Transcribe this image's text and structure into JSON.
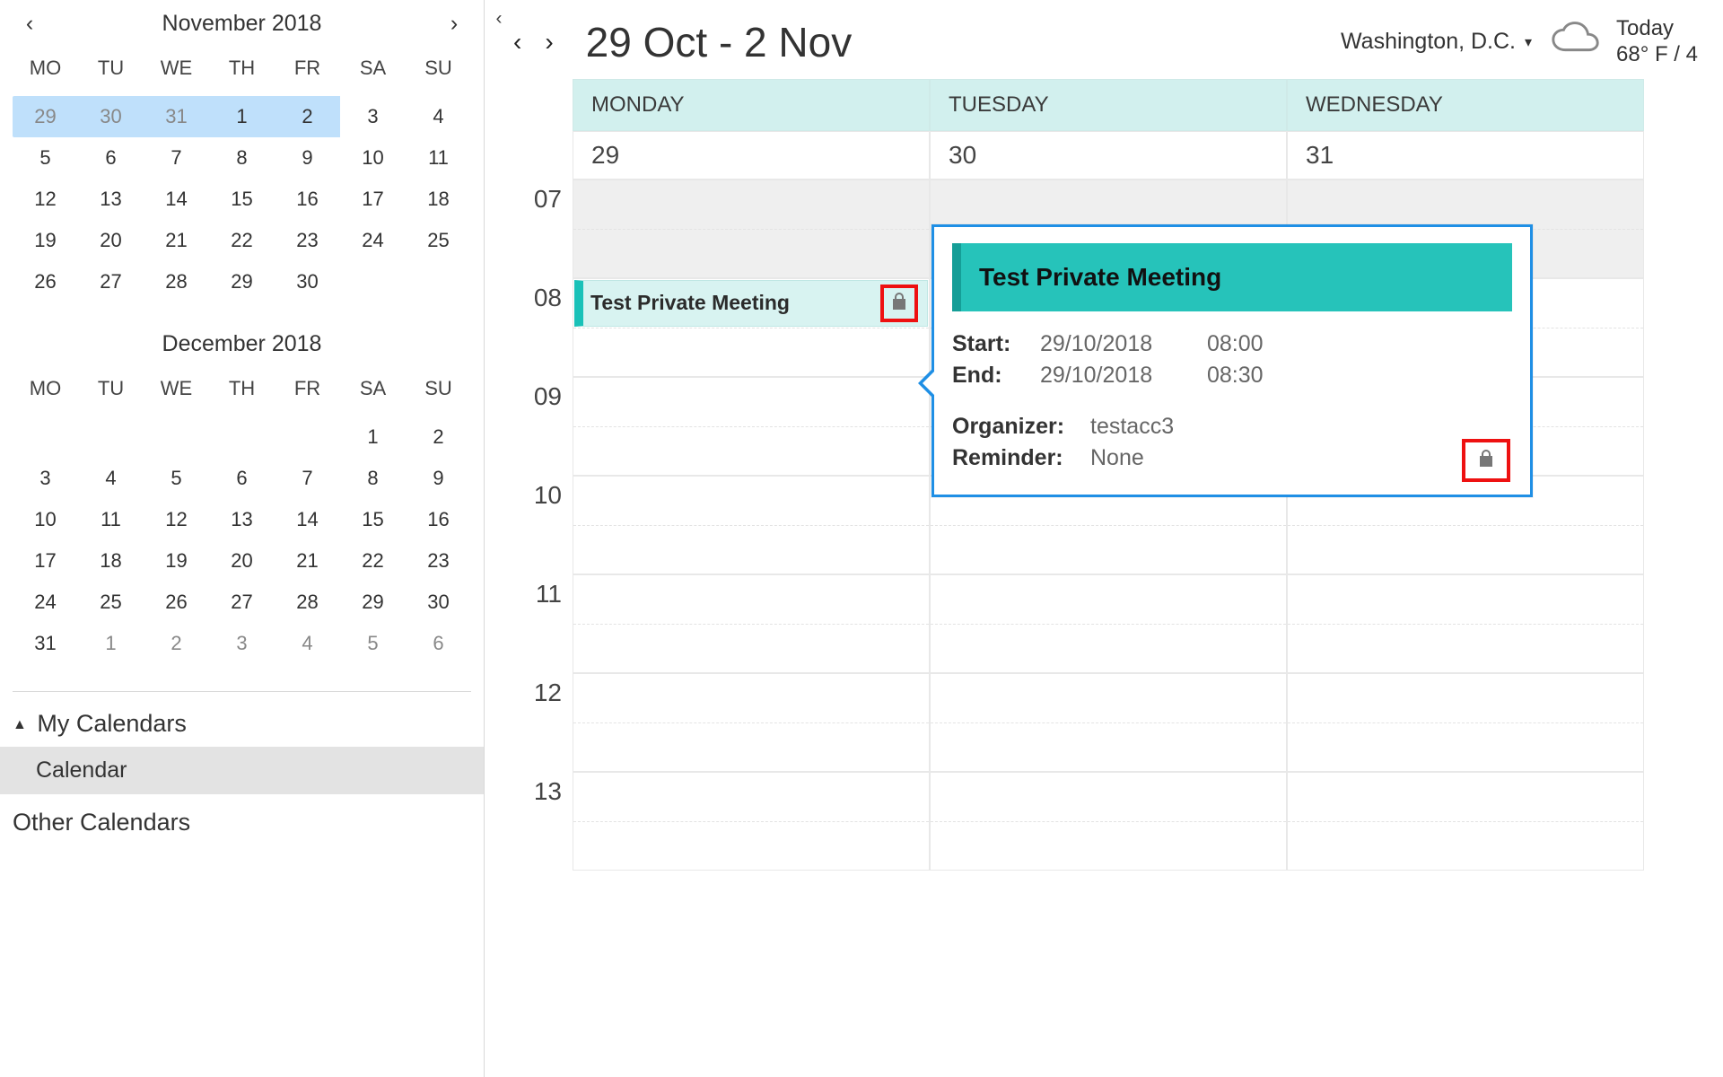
{
  "sidebar": {
    "collapse_icon": "chevron-left",
    "minis": [
      {
        "title": "November 2018",
        "show_nav": true,
        "dow": [
          "MO",
          "TU",
          "WE",
          "TH",
          "FR",
          "SA",
          "SU"
        ],
        "weeks": [
          {
            "cells": [
              {
                "n": "29",
                "cls": "prev sel"
              },
              {
                "n": "30",
                "cls": "prev sel"
              },
              {
                "n": "31",
                "cls": "prev sel"
              },
              {
                "n": "1",
                "cls": "sel"
              },
              {
                "n": "2",
                "cls": "sel"
              },
              {
                "n": "3"
              },
              {
                "n": "4"
              }
            ]
          },
          {
            "cells": [
              {
                "n": "5"
              },
              {
                "n": "6"
              },
              {
                "n": "7"
              },
              {
                "n": "8"
              },
              {
                "n": "9"
              },
              {
                "n": "10"
              },
              {
                "n": "11"
              }
            ]
          },
          {
            "cells": [
              {
                "n": "12"
              },
              {
                "n": "13"
              },
              {
                "n": "14"
              },
              {
                "n": "15"
              },
              {
                "n": "16"
              },
              {
                "n": "17"
              },
              {
                "n": "18"
              }
            ]
          },
          {
            "cells": [
              {
                "n": "19"
              },
              {
                "n": "20"
              },
              {
                "n": "21"
              },
              {
                "n": "22"
              },
              {
                "n": "23"
              },
              {
                "n": "24"
              },
              {
                "n": "25"
              }
            ]
          },
          {
            "cells": [
              {
                "n": "26"
              },
              {
                "n": "27"
              },
              {
                "n": "28"
              },
              {
                "n": "29"
              },
              {
                "n": "30"
              },
              {
                "n": "",
                "cls": "blank"
              },
              {
                "n": "",
                "cls": "blank"
              }
            ]
          }
        ]
      },
      {
        "title": "December 2018",
        "show_nav": false,
        "dow": [
          "MO",
          "TU",
          "WE",
          "TH",
          "FR",
          "SA",
          "SU"
        ],
        "weeks": [
          {
            "cells": [
              {
                "n": ""
              },
              {
                "n": ""
              },
              {
                "n": ""
              },
              {
                "n": ""
              },
              {
                "n": ""
              },
              {
                "n": "1"
              },
              {
                "n": "2"
              }
            ]
          },
          {
            "cells": [
              {
                "n": "3"
              },
              {
                "n": "4"
              },
              {
                "n": "5"
              },
              {
                "n": "6"
              },
              {
                "n": "7"
              },
              {
                "n": "8"
              },
              {
                "n": "9"
              }
            ]
          },
          {
            "cells": [
              {
                "n": "10"
              },
              {
                "n": "11"
              },
              {
                "n": "12"
              },
              {
                "n": "13"
              },
              {
                "n": "14"
              },
              {
                "n": "15"
              },
              {
                "n": "16"
              }
            ]
          },
          {
            "cells": [
              {
                "n": "17"
              },
              {
                "n": "18"
              },
              {
                "n": "19"
              },
              {
                "n": "20"
              },
              {
                "n": "21"
              },
              {
                "n": "22"
              },
              {
                "n": "23"
              }
            ]
          },
          {
            "cells": [
              {
                "n": "24"
              },
              {
                "n": "25"
              },
              {
                "n": "26"
              },
              {
                "n": "27"
              },
              {
                "n": "28"
              },
              {
                "n": "29"
              },
              {
                "n": "30"
              }
            ]
          },
          {
            "cells": [
              {
                "n": "31"
              },
              {
                "n": "1",
                "cls": "next"
              },
              {
                "n": "2",
                "cls": "next"
              },
              {
                "n": "3",
                "cls": "next"
              },
              {
                "n": "4",
                "cls": "next"
              },
              {
                "n": "5",
                "cls": "next"
              },
              {
                "n": "6",
                "cls": "next"
              }
            ]
          }
        ]
      }
    ],
    "groups": {
      "my_label": "My Calendars",
      "my_items": [
        "Calendar"
      ],
      "other_label": "Other Calendars"
    }
  },
  "topbar": {
    "range": "29 Oct - 2 Nov",
    "location": "Washington, D.C.",
    "today_label": "Today",
    "today_temp": "68° F / 4"
  },
  "dayheaders": [
    "MONDAY",
    "TUESDAY",
    "WEDNESDAY"
  ],
  "daynums": [
    "29",
    "30",
    "31"
  ],
  "timeslots": [
    "07",
    "08",
    "09",
    "10",
    "11",
    "12",
    "13"
  ],
  "event": {
    "title": "Test Private Meeting",
    "private": true
  },
  "popover": {
    "title": "Test Private Meeting",
    "start_label": "Start:",
    "start_date": "29/10/2018",
    "start_time": "08:00",
    "end_label": "End:",
    "end_date": "29/10/2018",
    "end_time": "08:30",
    "organizer_label": "Organizer:",
    "organizer": "testacc3",
    "reminder_label": "Reminder:",
    "reminder": "None",
    "private": true
  }
}
